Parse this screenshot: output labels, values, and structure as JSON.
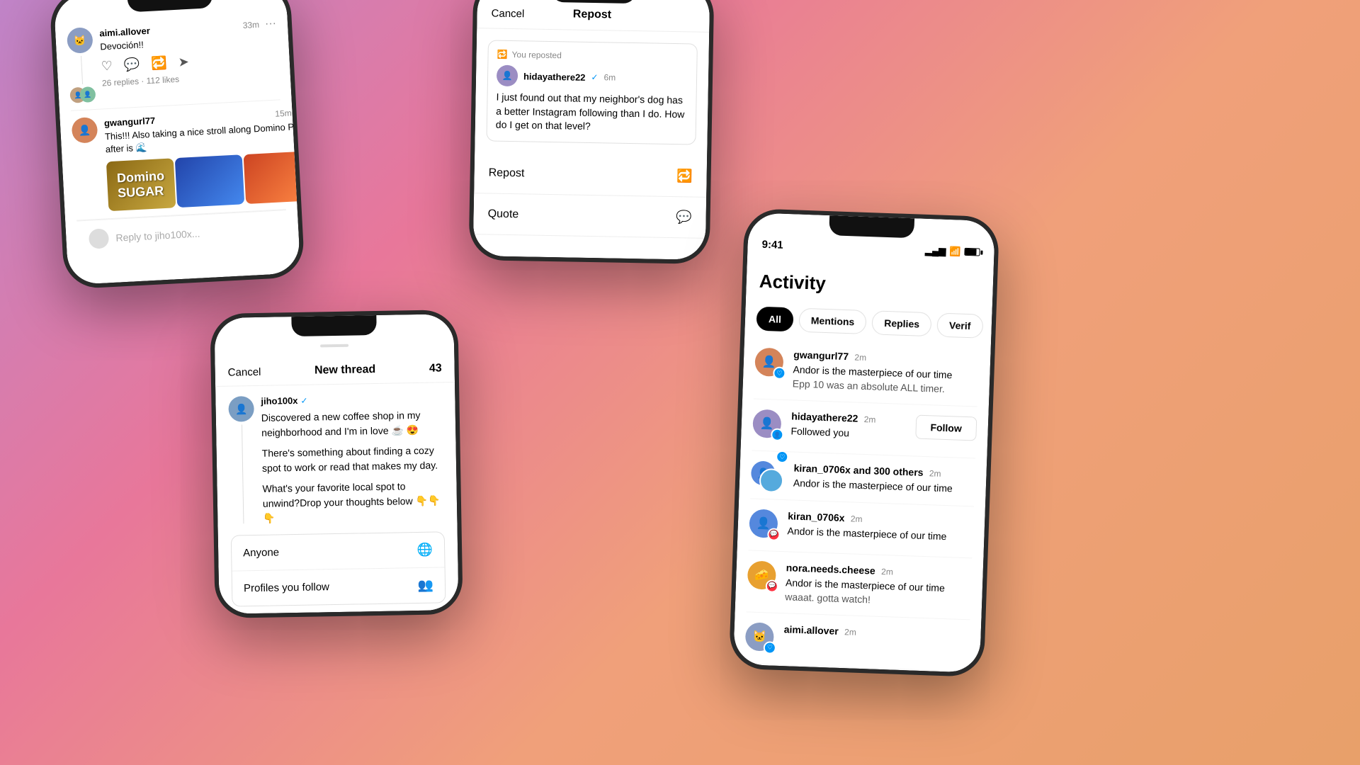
{
  "background": "linear-gradient(135deg, #c084c8 0%, #e8779a 30%, #f0a07a 60%, #e8a06a 100%)",
  "phone1": {
    "post1": {
      "username": "aimi.allover",
      "time": "33m",
      "text": "Devoción!!",
      "replies": "26 replies",
      "likes": "112 likes",
      "avatarEmoji": "🐱"
    },
    "post2": {
      "username": "gwangurl77",
      "time": "15m",
      "text": "This!!! Also taking a nice stroll along Domino Park after is 🌊",
      "avatarEmoji": "👤"
    },
    "reply_placeholder": "Reply to jiho100x..."
  },
  "phone2": {
    "cancel_label": "Cancel",
    "title": "Repost",
    "you_reposted": "You reposted",
    "post": {
      "username": "hidayathere22",
      "time": "6m",
      "text": "I just found out that my neighbor's dog has a better Instagram following than I do. How do I get on that level?",
      "header_text": "I just found out that my neighbor's dog has a"
    },
    "repost_label": "Repost",
    "quote_label": "Quote"
  },
  "phone3": {
    "cancel_label": "Cancel",
    "title": "New thread",
    "count": "43",
    "username": "jiho100x",
    "text1": "Discovered a new coffee shop in my neighborhood and I'm in love ☕️ 😍",
    "text2": "There's something about finding a cozy spot to work or read that makes my day.",
    "text3": "What's your favorite local spot to unwind?Drop your thoughts below 👇👇👇",
    "audience": {
      "anyone_label": "Anyone",
      "profiles_label": "Profiles you follow"
    }
  },
  "phone4": {
    "status_time": "9:41",
    "title": "Activity",
    "tabs": [
      "All",
      "Mentions",
      "Replies",
      "Verif"
    ],
    "active_tab": "All",
    "items": [
      {
        "username": "gwangurl77",
        "time": "2m",
        "text": "Andor is the masterpiece of our time",
        "subtext": "Epp 10 was an absolute ALL timer.",
        "badge_color": "blue",
        "avatarEmoji": "👤"
      },
      {
        "username": "hidayathere22",
        "time": "2m",
        "text": "Followed you",
        "show_follow": true,
        "badge_color": "blue",
        "avatarEmoji": "👤"
      },
      {
        "username": "kiran_0706x and 300 others",
        "time": "2m",
        "text": "Andor is the masterpiece of our time",
        "badge_color": "blue",
        "double_avatar": true,
        "avatarEmoji": "👤"
      },
      {
        "username": "kiran_0706x",
        "time": "2m",
        "text": "Andor is the masterpiece of our time",
        "badge_color": "red",
        "avatarEmoji": "👤"
      },
      {
        "username": "nora.needs.cheese",
        "time": "2m",
        "text": "Andor is the masterpiece of our time",
        "subtext": "waaat. gotta watch!",
        "badge_color": "red",
        "avatarEmoji": "🧀"
      },
      {
        "username": "aimi.allover",
        "time": "2m",
        "text": "",
        "badge_color": "blue",
        "avatarEmoji": "🐱"
      }
    ],
    "follow_button_label": "Follow"
  }
}
